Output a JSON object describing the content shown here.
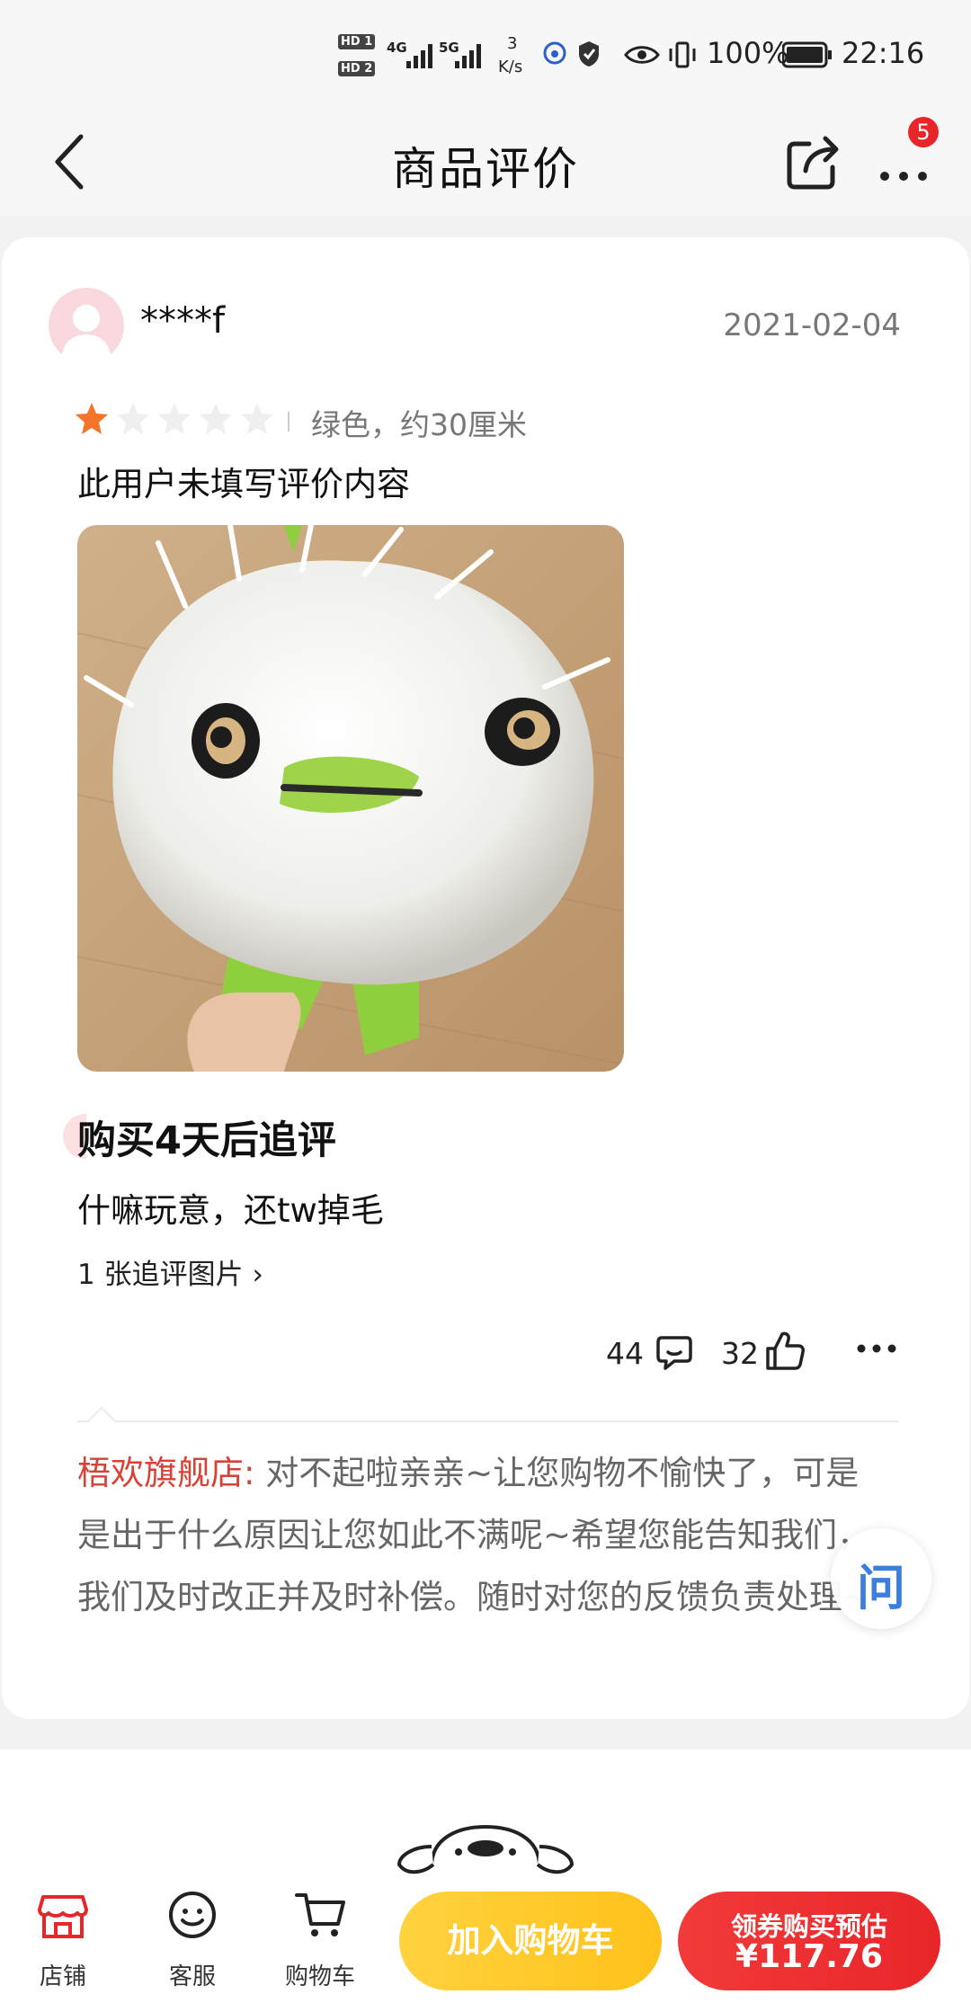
{
  "status_bar": {
    "network_speed_value": "3",
    "network_speed_unit": "K/s",
    "battery": "100%",
    "time": "22:16",
    "sim1": "HD 1",
    "sim2": "HD 2",
    "net1": "4G",
    "net2": "5G"
  },
  "nav": {
    "title": "商品评价",
    "badge": "5",
    "icons": [
      "back-arrow-icon",
      "share-icon",
      "more-icon"
    ]
  },
  "review": {
    "username": "****f",
    "date": "2021-02-04",
    "rating": 1,
    "rating_max": 5,
    "sku": "绿色，约30厘米",
    "text": "此用户未填写评价内容",
    "follow_up_title": "购买4天后追评",
    "follow_up_text": "什嘛玩意，还tw掉毛",
    "follow_up_images": "1 张追评图片",
    "comments": "44",
    "likes": "32"
  },
  "reply": {
    "shop": "梧欢旗舰店:",
    "text": "对不起啦亲亲~让您购物不愉快了，可是是出于什么原因让您如此不满呢~希望您能告知我们，我们及时改正并及时补偿。随时对您的反馈负责处理~"
  },
  "ask_bubble": {
    "label": "问"
  },
  "bottom_bar": {
    "tabs": [
      {
        "label": "店铺",
        "icon": "store-icon"
      },
      {
        "label": "客服",
        "icon": "customer-service-icon"
      },
      {
        "label": "购物车",
        "icon": "cart-icon"
      }
    ],
    "add_to_cart": "加入购物车",
    "buy_line1": "领券购买预估",
    "buy_price": "¥117.76"
  },
  "colors": {
    "star": "#f5742a",
    "shop_name": "#d84236",
    "cart_button": "#ffc21a",
    "buy_button": "#e8262a",
    "badge": "#e8262a"
  }
}
